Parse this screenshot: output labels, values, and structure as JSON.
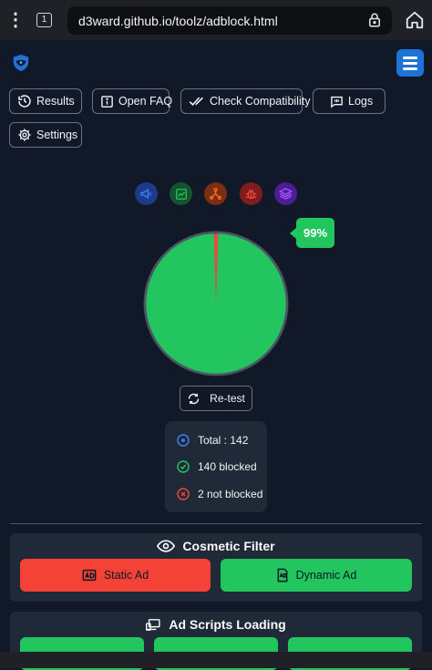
{
  "browser": {
    "url": "d3ward.github.io/toolz/adblock.html",
    "tab_count": "1"
  },
  "nav": {
    "results": "Results",
    "open_faq": "Open FAQ",
    "check_compatibility": "Check Compatibility",
    "logs": "Logs",
    "settings": "Settings"
  },
  "categories": [
    "megaphone-icon",
    "chart-icon",
    "analytics-icon",
    "bug-icon",
    "layers-icon"
  ],
  "score": {
    "percent": 99,
    "label": "99%",
    "colors": {
      "blocked": "#22c55e",
      "not_blocked": "#ef4444"
    }
  },
  "retest_label": "Re-test",
  "stats": {
    "total": "Total : 142",
    "blocked": "140 blocked",
    "not_blocked": "2 not blocked"
  },
  "cosmetic": {
    "title": "Cosmetic Filter",
    "static_ad": "Static Ad",
    "dynamic_ad": "Dynamic Ad"
  },
  "ad_scripts": {
    "title": "Ad Scripts Loading"
  }
}
